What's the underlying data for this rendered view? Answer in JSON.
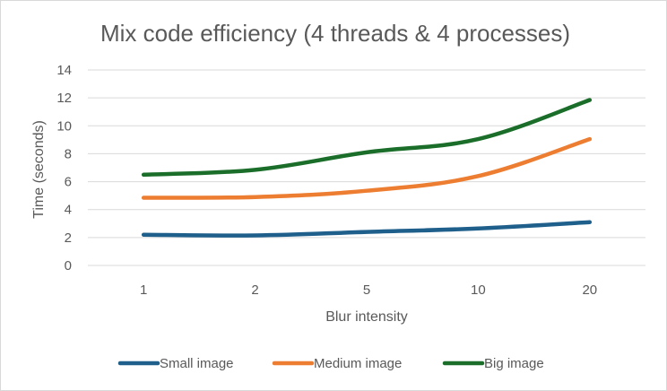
{
  "chart_data": {
    "type": "line",
    "title": "Mix code efficiency (4 threads & 4 processes)",
    "xlabel": "Blur intensity",
    "ylabel": "Time (seconds)",
    "categories": [
      "1",
      "2",
      "5",
      "10",
      "20"
    ],
    "ylim": [
      0,
      14
    ],
    "yticks": [
      0,
      2,
      4,
      6,
      8,
      10,
      12,
      14
    ],
    "grid": true,
    "legend_position": "bottom",
    "series": [
      {
        "name": "Small image",
        "color": "#1f5f8b",
        "values": [
          2.2,
          2.15,
          2.4,
          2.65,
          3.1
        ]
      },
      {
        "name": "Medium image",
        "color": "#ed7d31",
        "values": [
          4.85,
          4.9,
          5.35,
          6.4,
          9.05
        ]
      },
      {
        "name": "Big image",
        "color": "#1a6e2a",
        "values": [
          6.5,
          6.85,
          8.1,
          9.05,
          11.85
        ]
      }
    ]
  }
}
